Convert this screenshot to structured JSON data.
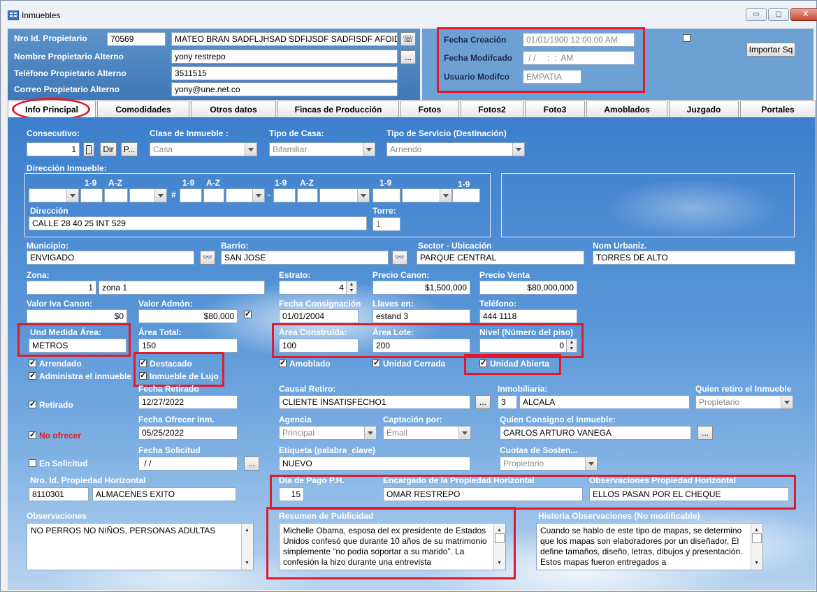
{
  "window": {
    "title": "Inmuebles",
    "min": "▭",
    "max": "▢",
    "close": "X"
  },
  "header": {
    "owner_id_label": "Nro Id. Propietario",
    "owner_id": "70569",
    "owner_name": "MATEO BRAN SADFLJHSAD SDFIJSDF SADFISDF AFOID",
    "alt_name_label": "Nombre Propietario Alterno",
    "alt_name": "yony restrepo",
    "alt_phone_label": "Teléfono Propietario Alterno",
    "alt_phone": "3511515",
    "alt_email_label": "Correo Propietario Alterno",
    "alt_email": "yony@une.net.co",
    "browse_btn": "...",
    "created_label": "Fecha Creación",
    "created": "01/01/1900 12:00:00 AM",
    "modified_label": "Fecha Modifcado",
    "modified": " / /     :  :  AM",
    "user_label": "Usuario Modifco",
    "user": "EMPATIA",
    "import_btn": "Importar Sq"
  },
  "tabs": [
    "Info Principal",
    "Comodidades",
    "Otros datos",
    "Fincas de Producción",
    "Fotos",
    "Fotos2",
    "Foto3",
    "Amoblados",
    "Juzgado",
    "Portales"
  ],
  "form": {
    "consecutivo_label": "Consecutivo:",
    "consecutivo": "1",
    "btn_dir": "Dir",
    "btn_p": "P...",
    "clase_label": "Clase de Inmueble :",
    "clase": "Casa",
    "tipo_casa_label": "Tipo de Casa:",
    "tipo_casa": "Bifamiliar",
    "tipo_servicio_label": "Tipo de Servicio (Destinación)",
    "tipo_servicio": "Arriendo",
    "direccion_inmueble_label": "Dirección Inmueble:",
    "col_19": "1-9",
    "col_az": "A-Z",
    "hash": "#",
    "dash": "-",
    "direccion_label": "Dirección",
    "direccion": "CALLE 28 40 25 INT 529",
    "torre_label": "Torre:",
    "torre": "1",
    "municipio_label": "Municipio:",
    "municipio": "ENVIGADO",
    "barrio_label": "Barrio:",
    "barrio": "SAN JOSE",
    "sector_label": "Sector - Ubicación",
    "sector": "PARQUE CENTRAL",
    "urbaniz_label": "Nom Urbaniz.",
    "urbaniz": "TORRES DE ALTO",
    "zona_label": "Zona:",
    "zona_num": "1",
    "zona": "zona 1",
    "estrato_label": "Estrato:",
    "estrato": "4",
    "precio_canon_label": "Precio Canon:",
    "precio_canon": "$1,500,000",
    "precio_venta_label": "Precio Venta",
    "precio_venta": "$80,000,000",
    "iva_label": "Valor Iva Canon:",
    "iva": "$0",
    "admon_label": "Valor Admón:",
    "admon": "$80,000",
    "consignacion_label": "Fecha Consignación",
    "consignacion": "01/01/2004",
    "llaves_label": "Llaves en:",
    "llaves": "estand 3",
    "telefono_label": "Teléfono:",
    "telefono": "444 1118",
    "und_label": "Und Medida Área:",
    "und": "METROS",
    "area_total_label": "Área Total:",
    "area_total": "150",
    "area_construida_label": "Área Construída:",
    "area_construida": "100",
    "area_lote_label": "Área Lote:",
    "area_lote": "200",
    "nivel_label": "Nivel (Número del piso)",
    "nivel": "0",
    "arrendado": "Arrendado",
    "administra": "Administra el inmueble",
    "destacado": "Destacado",
    "lujo": "Inmueble de Lujo",
    "amoblado": "Amoblado",
    "unidad_cerrada": "Unidad Cerrada",
    "unidad_abierta": "Unidad Abierta",
    "retirado": "Retirado",
    "fecha_retirado_label": "Fecha Retirado",
    "fecha_retirado": "12/27/2022",
    "causal_label": "Causal Retiro:",
    "causal": "CLIENTE INSATISFECHO1",
    "inmobiliaria_label": "Inmobiliaria:",
    "inmobiliaria_num": "3",
    "inmobiliaria": "ALCALA",
    "quien_retiro_label": "Quien retiro el Inmueble",
    "quien_retiro": "Propietario",
    "no_ofrecer": "No ofrecer",
    "fecha_ofrecer_label": "Fecha Ofrecer Inm.",
    "fecha_ofrecer": "05/25/2022",
    "agencia_label": "Agencia",
    "agencia": "Principal",
    "captacion_label": "Captación por:",
    "captacion": "Email",
    "quien_consigno_label": "Quien Consigno el Inmueble:",
    "quien_consigno": "CARLOS ARTURO VANEGA",
    "en_solicitud": "En Solicitud",
    "fecha_solicitud_label": "Fecha Solicitud",
    "fecha_solicitud": " / /",
    "etiqueta_label": "Etiqueta (palabra_clave)",
    "etiqueta": "NUEVO",
    "cuotas_label": "Cuotas de Sosten...",
    "cuotas": "Propietario",
    "ph_id_label": "Nro. Id. Propiedad Horizontal",
    "ph_id": "8110301",
    "ph_name": "ALMACENES EXITO",
    "dia_pago_label": "Día de Pago P.H.",
    "dia_pago": "15",
    "encargado_label": "Encargado de la Propiedad Horizontal",
    "encargado": "OMAR RESTREPO",
    "obs_ph_label": "Observaciones Propiedad Horizontal",
    "obs_ph": "ELLOS PASAN POR EL CHEQUE",
    "observaciones_label": "Observaciones",
    "observaciones": "NO PERROS NO NIÑOS, PERSONAS ADULTAS",
    "resumen_label": "Resumen de Publicidad",
    "resumen": "Michelle Obama, esposa del ex presidente de Estados Unidos confesó que durante 10 años de su matrimonio simplemente “no podía soportar a su marido”. La confesión la hizo durante una entrevista",
    "historia_label": "Historia Observaciones (No modificable)",
    "historia": "Cuando se hablo de este tipo de mapas, se determino que los mapas son elaboradores por un diseñador, El define tamaños, diseño, letras, dibujos y presentación. Estos mapas fueron entregados a"
  },
  "icons": {
    "phone": "phone-icon",
    "binoculars": "binoculars-icon"
  },
  "colors": {
    "highlight": "#e01a2a",
    "label": "#ffffff",
    "no_ofrecer": "#e02020"
  }
}
